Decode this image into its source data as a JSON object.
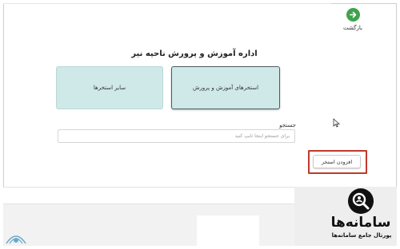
{
  "header": {
    "back_label": "بازگشت",
    "back_icon": "arrow-right-icon",
    "back_color": "#3fa34d"
  },
  "page": {
    "title": "اداره آموزش و پرورش ناحیه نیر"
  },
  "cards": {
    "education_pools": "استخرهای آموزش و پرورش",
    "other_pools": "سایر استخرها",
    "card_color": "#cfe8e8"
  },
  "search": {
    "label": "جستجو",
    "placeholder": "برای جستجو اینجا تایپ کنید"
  },
  "actions": {
    "add_pool_label": "افزودن استخر",
    "highlight_color": "#c0392b"
  },
  "brand": {
    "name": "سامانه‌ها",
    "tagline": "پورتال جامع سامانه‌ها"
  }
}
